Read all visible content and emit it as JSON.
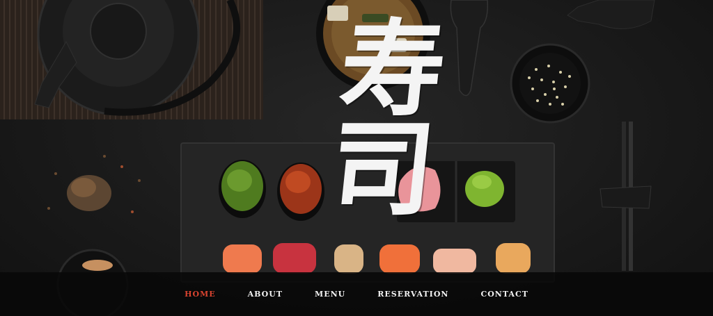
{
  "hero": {
    "logo_text": "寿司",
    "logo_description": "brush calligraphy sushi characters"
  },
  "nav": {
    "items": [
      {
        "label": "HOME",
        "active": true
      },
      {
        "label": "ABOUT",
        "active": false
      },
      {
        "label": "MENU",
        "active": false
      },
      {
        "label": "RESERVATION",
        "active": false
      },
      {
        "label": "CONTACT",
        "active": false
      }
    ],
    "active_color": "#d9432f",
    "text_color": "#f2f2f2"
  }
}
